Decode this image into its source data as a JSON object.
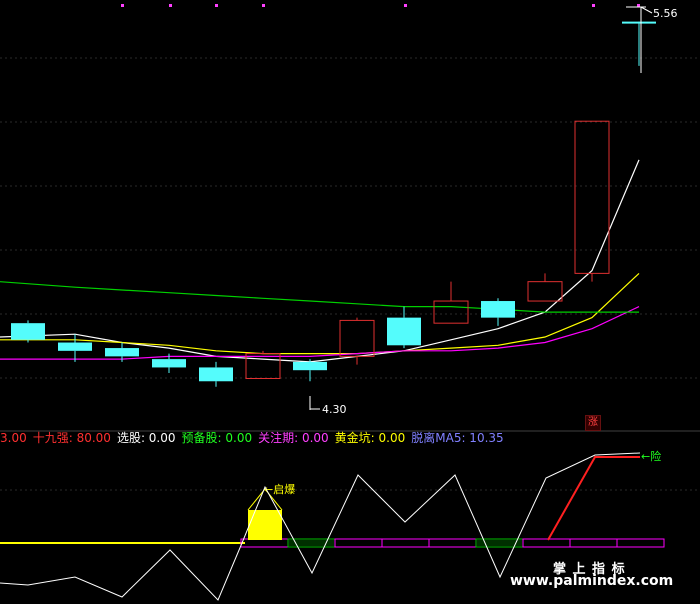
{
  "colors": {
    "background": "#000000",
    "up_candle": "#e03030",
    "down_candle": "#54fcfc",
    "ma_white": "#ffffff",
    "ma_yellow": "#ffff00",
    "ma_magenta": "#ff00ff",
    "ma_green": "#00d000",
    "indicator_bar": "#ffff00"
  },
  "price_labels": {
    "high": "5.56",
    "low": "4.30"
  },
  "zhang_badge": "涨",
  "indicator_row": [
    {
      "label": "",
      "value": "3.00",
      "color": "#ff3030"
    },
    {
      "label": "十九强:",
      "value": "80.00",
      "color": "#ff3030"
    },
    {
      "label": "选股:",
      "value": "0.00",
      "color": "#ffffff"
    },
    {
      "label": "预备股:",
      "value": "0.00",
      "color": "#20ff20"
    },
    {
      "label": "关注期:",
      "value": "0.00",
      "color": "#ff40ff"
    },
    {
      "label": "黄金坑:",
      "value": "0.00",
      "color": "#ffff00"
    },
    {
      "label": "脱离MA5:",
      "value": "10.35",
      "color": "#8080ff"
    }
  ],
  "annotations": {
    "qibao": "启爆",
    "xian": "险"
  },
  "watermark": {
    "cn": "掌 上 指 标",
    "url": "www.palmindex.com"
  },
  "chart_data": {
    "type": "candlestick",
    "candles": [
      {
        "open": 4.47,
        "close": 4.41,
        "high": 4.48,
        "low": 4.4
      },
      {
        "open": 4.4,
        "close": 4.37,
        "high": 4.43,
        "low": 4.33
      },
      {
        "open": 4.38,
        "close": 4.35,
        "high": 4.4,
        "low": 4.33
      },
      {
        "open": 4.34,
        "close": 4.31,
        "high": 4.36,
        "low": 4.29
      },
      {
        "open": 4.31,
        "close": 4.26,
        "high": 4.33,
        "low": 4.24
      },
      {
        "open": 4.27,
        "close": 4.36,
        "high": 4.37,
        "low": 4.27
      },
      {
        "open": 4.33,
        "close": 4.3,
        "high": 4.34,
        "low": 4.26
      },
      {
        "open": 4.35,
        "close": 4.48,
        "high": 4.49,
        "low": 4.32
      },
      {
        "open": 4.49,
        "close": 4.39,
        "high": 4.53,
        "low": 4.38
      },
      {
        "open": 4.47,
        "close": 4.55,
        "high": 4.62,
        "low": 4.47
      },
      {
        "open": 4.55,
        "close": 4.49,
        "high": 4.56,
        "low": 4.46
      },
      {
        "open": 4.55,
        "close": 4.62,
        "high": 4.65,
        "low": 4.55
      },
      {
        "open": 4.65,
        "close": 5.2,
        "high": 5.2,
        "low": 4.62
      },
      {
        "open": 5.56,
        "close": 5.56,
        "high": 5.56,
        "low": 5.4
      }
    ],
    "ma_lines": [
      {
        "name": "MA-white",
        "color": "#ffffff",
        "values": [
          4.42,
          4.43,
          4.4,
          4.38,
          4.35,
          4.34,
          4.33,
          4.35,
          4.37,
          4.41,
          4.45,
          4.51,
          4.66,
          5.06
        ]
      },
      {
        "name": "MA-yellow",
        "color": "#ffff00",
        "values": [
          4.41,
          4.41,
          4.4,
          4.39,
          4.37,
          4.36,
          4.36,
          4.36,
          4.37,
          4.38,
          4.39,
          4.42,
          4.49,
          4.65
        ]
      },
      {
        "name": "MA-magenta",
        "color": "#ff00ff",
        "values": [
          4.34,
          4.34,
          4.34,
          4.35,
          4.35,
          4.35,
          4.35,
          4.36,
          4.37,
          4.37,
          4.38,
          4.4,
          4.45,
          4.53
        ]
      },
      {
        "name": "MA-green",
        "color": "#00d000",
        "values": [
          4.62,
          4.6,
          4.59,
          4.58,
          4.57,
          4.56,
          4.55,
          4.54,
          4.53,
          4.53,
          4.52,
          4.51,
          4.51,
          4.51
        ]
      }
    ],
    "price_range": [
      4.12,
      5.62
    ],
    "indicator": {
      "white_line": [
        68,
        70,
        62,
        75,
        55,
        75,
        0,
        130,
        30,
        130,
        80,
        125,
        30,
        70,
        140,
        170,
        170,
        172
      ],
      "red_line": [
        0,
        90,
        168,
        168,
        170
      ],
      "yellow_bar_value": 60,
      "range": [
        0,
        180
      ]
    }
  }
}
